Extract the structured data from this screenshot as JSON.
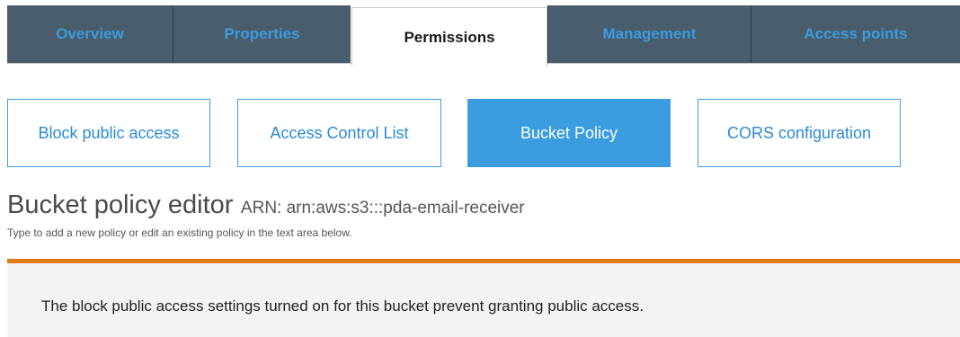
{
  "top_tabs": [
    {
      "label": "Overview",
      "active": false
    },
    {
      "label": "Properties",
      "active": false
    },
    {
      "label": "Permissions",
      "active": true
    },
    {
      "label": "Management",
      "active": false
    },
    {
      "label": "Access points",
      "active": false
    }
  ],
  "sub_tabs": [
    {
      "label": "Block public access",
      "active": false
    },
    {
      "label": "Access Control List",
      "active": false
    },
    {
      "label": "Bucket Policy",
      "active": true
    },
    {
      "label": "CORS configuration",
      "active": false
    }
  ],
  "editor": {
    "title": "Bucket policy editor",
    "arn": "ARN: arn:aws:s3:::pda-email-receiver",
    "hint": "Type to add a new policy or edit an existing policy in the text area below."
  },
  "banner": {
    "text": "The block public access settings turned on for this bucket prevent granting public access."
  },
  "colors": {
    "tab_dark": "#4a5d6c",
    "tab_text": "#3b9ce0",
    "accent_blue": "#3b9ce0",
    "warning_orange": "#e07b12",
    "banner_bg": "#f2f3f3"
  }
}
